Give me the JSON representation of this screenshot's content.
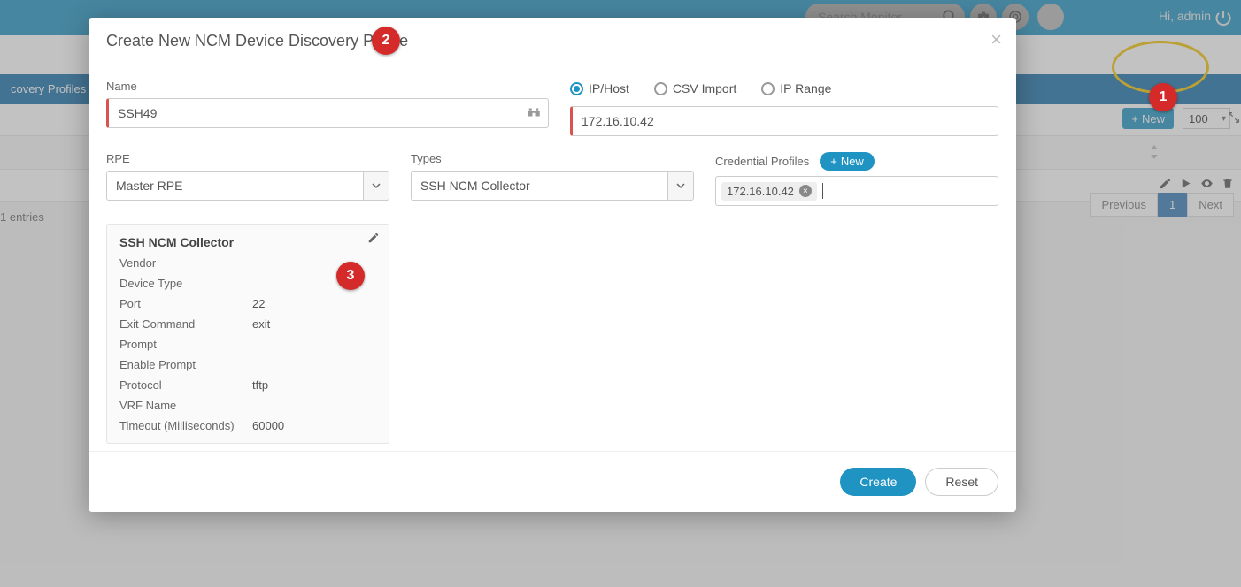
{
  "topbar": {
    "search_placeholder": "Search Monitor",
    "greeting": "Hi, admin"
  },
  "bluebar": {
    "tab_label": "covery Profiles"
  },
  "toolbar": {
    "new_label": "New",
    "page_size": "100"
  },
  "grid": {
    "entries_text": "1 entries"
  },
  "pager": {
    "prev": "Previous",
    "page": "1",
    "next": "Next"
  },
  "modal": {
    "title": "Create New NCM Device Discovery Profile",
    "name_label": "Name",
    "name_value": "SSH49",
    "source": {
      "options": [
        "IP/Host",
        "CSV Import",
        "IP Range"
      ],
      "selected": "IP/Host",
      "value": "172.16.10.42"
    },
    "rpe_label": "RPE",
    "rpe_value": "Master RPE",
    "types_label": "Types",
    "types_value": "SSH NCM Collector",
    "cred_label": "Credential Profiles",
    "cred_new": "New",
    "cred_tag": "172.16.10.42",
    "collector": {
      "title": "SSH NCM Collector",
      "fields": {
        "vendor_l": "Vendor",
        "vendor_v": "",
        "device_type_l": "Device Type",
        "device_type_v": "",
        "port_l": "Port",
        "port_v": "22",
        "exit_l": "Exit Command",
        "exit_v": "exit",
        "prompt_l": "Prompt",
        "prompt_v": "",
        "enable_l": "Enable Prompt",
        "enable_v": "",
        "protocol_l": "Protocol",
        "protocol_v": "tftp",
        "vrf_l": "VRF Name",
        "vrf_v": "",
        "timeout_l": "Timeout (Milliseconds)",
        "timeout_v": "60000"
      }
    },
    "create_btn": "Create",
    "reset_btn": "Reset"
  },
  "annotations": {
    "b1": "1",
    "b2": "2",
    "b3": "3"
  }
}
